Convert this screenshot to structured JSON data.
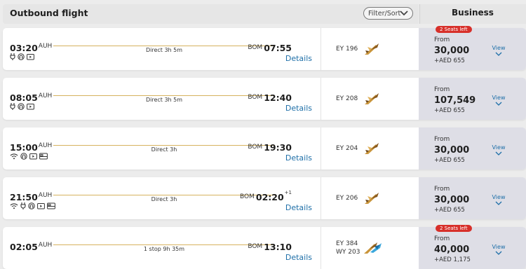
{
  "header": {
    "title": "Outbound flight",
    "filter_label": "Filter/Sort",
    "cabin_class": "Business"
  },
  "flights": [
    {
      "dep_time": "03:20",
      "dep_code": "AUH",
      "arr_time": "07:55",
      "arr_code": "BOM",
      "day_offset": "",
      "duration": "Direct 3h 5m",
      "amenities": [
        "power-icon",
        "headphones-icon",
        "tv-icon"
      ],
      "details_label": "Details",
      "flight_numbers": [
        "EY 196"
      ],
      "airline_logo": "etihad-logo",
      "badge": "2 Seats left",
      "from_label": "From",
      "price": "30,000",
      "tax": "+AED 655",
      "view_label": "View"
    },
    {
      "dep_time": "08:05",
      "dep_code": "AUH",
      "arr_time": "12:40",
      "arr_code": "BOM",
      "day_offset": "",
      "duration": "Direct 3h 5m",
      "amenities": [
        "power-icon",
        "headphones-icon",
        "tv-icon"
      ],
      "details_label": "Details",
      "flight_numbers": [
        "EY 208"
      ],
      "airline_logo": "etihad-logo",
      "badge": "",
      "from_label": "From",
      "price": "107,549",
      "tax": "+AED 655",
      "view_label": "View"
    },
    {
      "dep_time": "15:00",
      "dep_code": "AUH",
      "arr_time": "19:30",
      "arr_code": "BOM",
      "day_offset": "",
      "duration": "Direct 3h",
      "amenities": [
        "wifi-icon",
        "headphones-icon",
        "tv-icon",
        "bed-icon"
      ],
      "details_label": "Details",
      "flight_numbers": [
        "EY 204"
      ],
      "airline_logo": "etihad-logo",
      "badge": "",
      "from_label": "From",
      "price": "30,000",
      "tax": "+AED 655",
      "view_label": "View"
    },
    {
      "dep_time": "21:50",
      "dep_code": "AUH",
      "arr_time": "02:20",
      "arr_code": "BOM",
      "day_offset": "+1",
      "duration": "Direct 3h",
      "amenities": [
        "wifi-icon",
        "power-icon",
        "headphones-icon",
        "tv-icon",
        "bed-icon"
      ],
      "details_label": "Details",
      "flight_numbers": [
        "EY 206"
      ],
      "airline_logo": "etihad-logo",
      "badge": "",
      "from_label": "From",
      "price": "30,000",
      "tax": "+AED 655",
      "view_label": "View"
    },
    {
      "dep_time": "02:05",
      "dep_code": "AUH",
      "arr_time": "13:10",
      "arr_code": "BOM",
      "day_offset": "",
      "duration": "1 stop 9h 35m",
      "amenities": [],
      "details_label": "Details",
      "flight_numbers": [
        "EY 384",
        "WY 203"
      ],
      "airline_logo": "etihad-oman-air-logo",
      "badge": "2 Seats left",
      "from_label": "From",
      "price": "40,000",
      "tax": "+AED 1,175",
      "view_label": "View"
    }
  ],
  "colors": {
    "accent_link": "#1e6fa8",
    "badge": "#d7302a",
    "route_line": "#d6b25e",
    "fare_panel": "#dedee6",
    "etihad_gold": "#c9953b"
  }
}
